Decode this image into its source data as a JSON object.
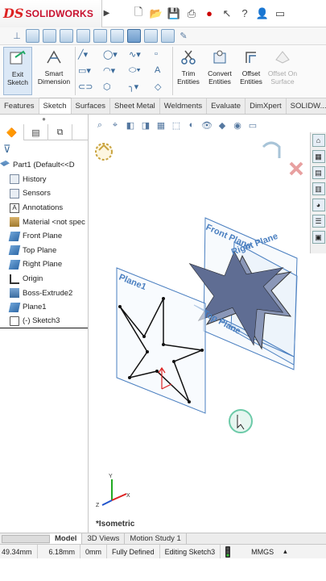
{
  "app": {
    "brand": "SOLIDWORKS",
    "brand_prefix": "DS"
  },
  "title_toolbar": {
    "icons": [
      "new-icon",
      "open-icon",
      "save-icon",
      "print-icon",
      "undo-icon",
      "traffic-light-icon",
      "select-icon",
      "help-icon",
      "user-icon",
      "window-icon"
    ]
  },
  "ribbon": {
    "exit_sketch": "Exit Sketch",
    "smart_dimension": "Smart Dimension",
    "trim_entities": "Trim Entities",
    "convert_entities": "Convert Entities",
    "offset_entities": "Offset Entities",
    "offset_on_surface": "Offset On Surface"
  },
  "command_tabs": [
    "Features",
    "Sketch",
    "Surfaces",
    "Sheet Metal",
    "Weldments",
    "Evaluate",
    "DimXpert",
    "SOLIDW..."
  ],
  "active_command_tab": "Sketch",
  "feature_tree": {
    "part": "Part1  (Default<<D",
    "items": [
      {
        "label": "History",
        "icon": "history-icon"
      },
      {
        "label": "Sensors",
        "icon": "sensor-icon"
      },
      {
        "label": "Annotations",
        "icon": "annotation-icon"
      },
      {
        "label": "Material <not spec",
        "icon": "material-icon"
      },
      {
        "label": "Front Plane",
        "icon": "plane-icon"
      },
      {
        "label": "Top Plane",
        "icon": "plane-icon"
      },
      {
        "label": "Right Plane",
        "icon": "plane-icon"
      },
      {
        "label": "Origin",
        "icon": "origin-icon"
      },
      {
        "label": "Boss-Extrude2",
        "icon": "extrude-icon"
      },
      {
        "label": "Plane1",
        "icon": "plane-icon"
      },
      {
        "label": "(-) Sketch3",
        "icon": "sketch-icon"
      }
    ]
  },
  "graphics": {
    "plane_labels": {
      "front": "Front Plane",
      "right": "Right Plane",
      "top": "Top Plane",
      "plane1": "Plane1"
    },
    "view_name": "*Isometric",
    "triad": {
      "x": "X",
      "y": "Y",
      "z": "Z"
    }
  },
  "bottom_tabs": [
    "Model",
    "3D Views",
    "Motion Study 1"
  ],
  "active_bottom_tab": "Model",
  "status_bar": {
    "x": "49.34mm",
    "y": "6.18mm",
    "z": "0mm",
    "state": "Fully Defined",
    "mode": "Editing Sketch3",
    "units": "MMGS"
  },
  "colors": {
    "brand_red": "#c8102e",
    "plane_blue": "#4a7fc0",
    "star_fill": "#6f7fa3"
  }
}
